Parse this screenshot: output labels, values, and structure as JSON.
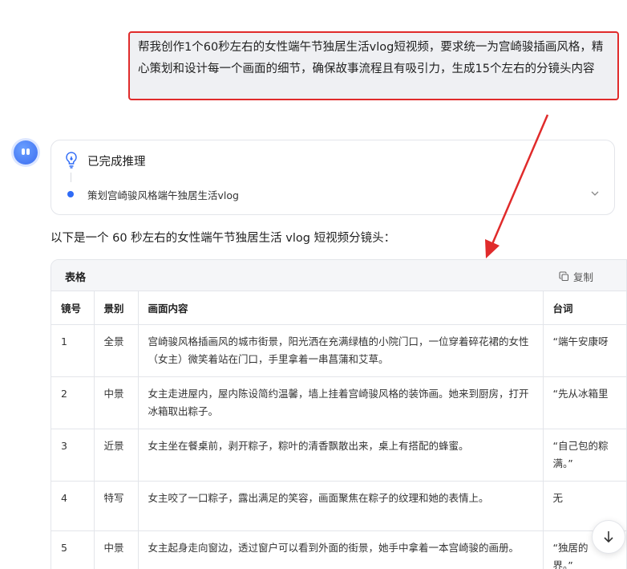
{
  "user_message": "帮我创作1个60秒左右的女性端午节独居生活vlog短视频，要求统一为宫崎骏插画风格，精心策划和设计每一个画面的细节，确保故事流程且有吸引力，生成15个左右的分镜头内容",
  "reasoning": {
    "status": "已完成推理",
    "step": "策划宫崎骏风格端午独居生活vlog"
  },
  "intro": "以下是一个 60 秒左右的女性端午节独居生活 vlog 短视频分镜头：",
  "table": {
    "title": "表格",
    "copy_label": "复制",
    "headers": [
      "镜号",
      "景别",
      "画面内容",
      "台词"
    ],
    "rows": [
      {
        "no": "1",
        "shot": "全景",
        "content": "宫崎骏风格插画风的城市街景，阳光洒在充满绿植的小院门口，一位穿着碎花裙的女性（女主）微笑着站在门口，手里拿着一串菖蒲和艾草。",
        "line": "“端午安康呀"
      },
      {
        "no": "2",
        "shot": "中景",
        "content": "女主走进屋内，屋内陈设简约温馨，墙上挂着宫崎骏风格的装饰画。她来到厨房，打开冰箱取出粽子。",
        "line": "“先从冰箱里"
      },
      {
        "no": "3",
        "shot": "近景",
        "content": "女主坐在餐桌前，剥开粽子，粽叶的清香飘散出来，桌上有搭配的蜂蜜。",
        "line": "“自己包的粽\n满。”"
      },
      {
        "no": "4",
        "shot": "特写",
        "content": "女主咬了一口粽子，露出满足的笑容，画面聚焦在粽子的纹理和她的表情上。",
        "line": "无"
      },
      {
        "no": "5",
        "shot": "中景",
        "content": "女主起身走向窗边，透过窗户可以看到外面的街景，她手中拿着一本宫崎骏的画册。",
        "line": "“独居的\n界。”"
      }
    ]
  },
  "icons": {
    "bulb": "lightbulb-icon",
    "chevron": "chevron-down-icon",
    "copy": "copy-icon",
    "scroll": "arrow-down-icon"
  },
  "colors": {
    "accent": "#2f6bf6",
    "highlight": "#e02b2b"
  }
}
